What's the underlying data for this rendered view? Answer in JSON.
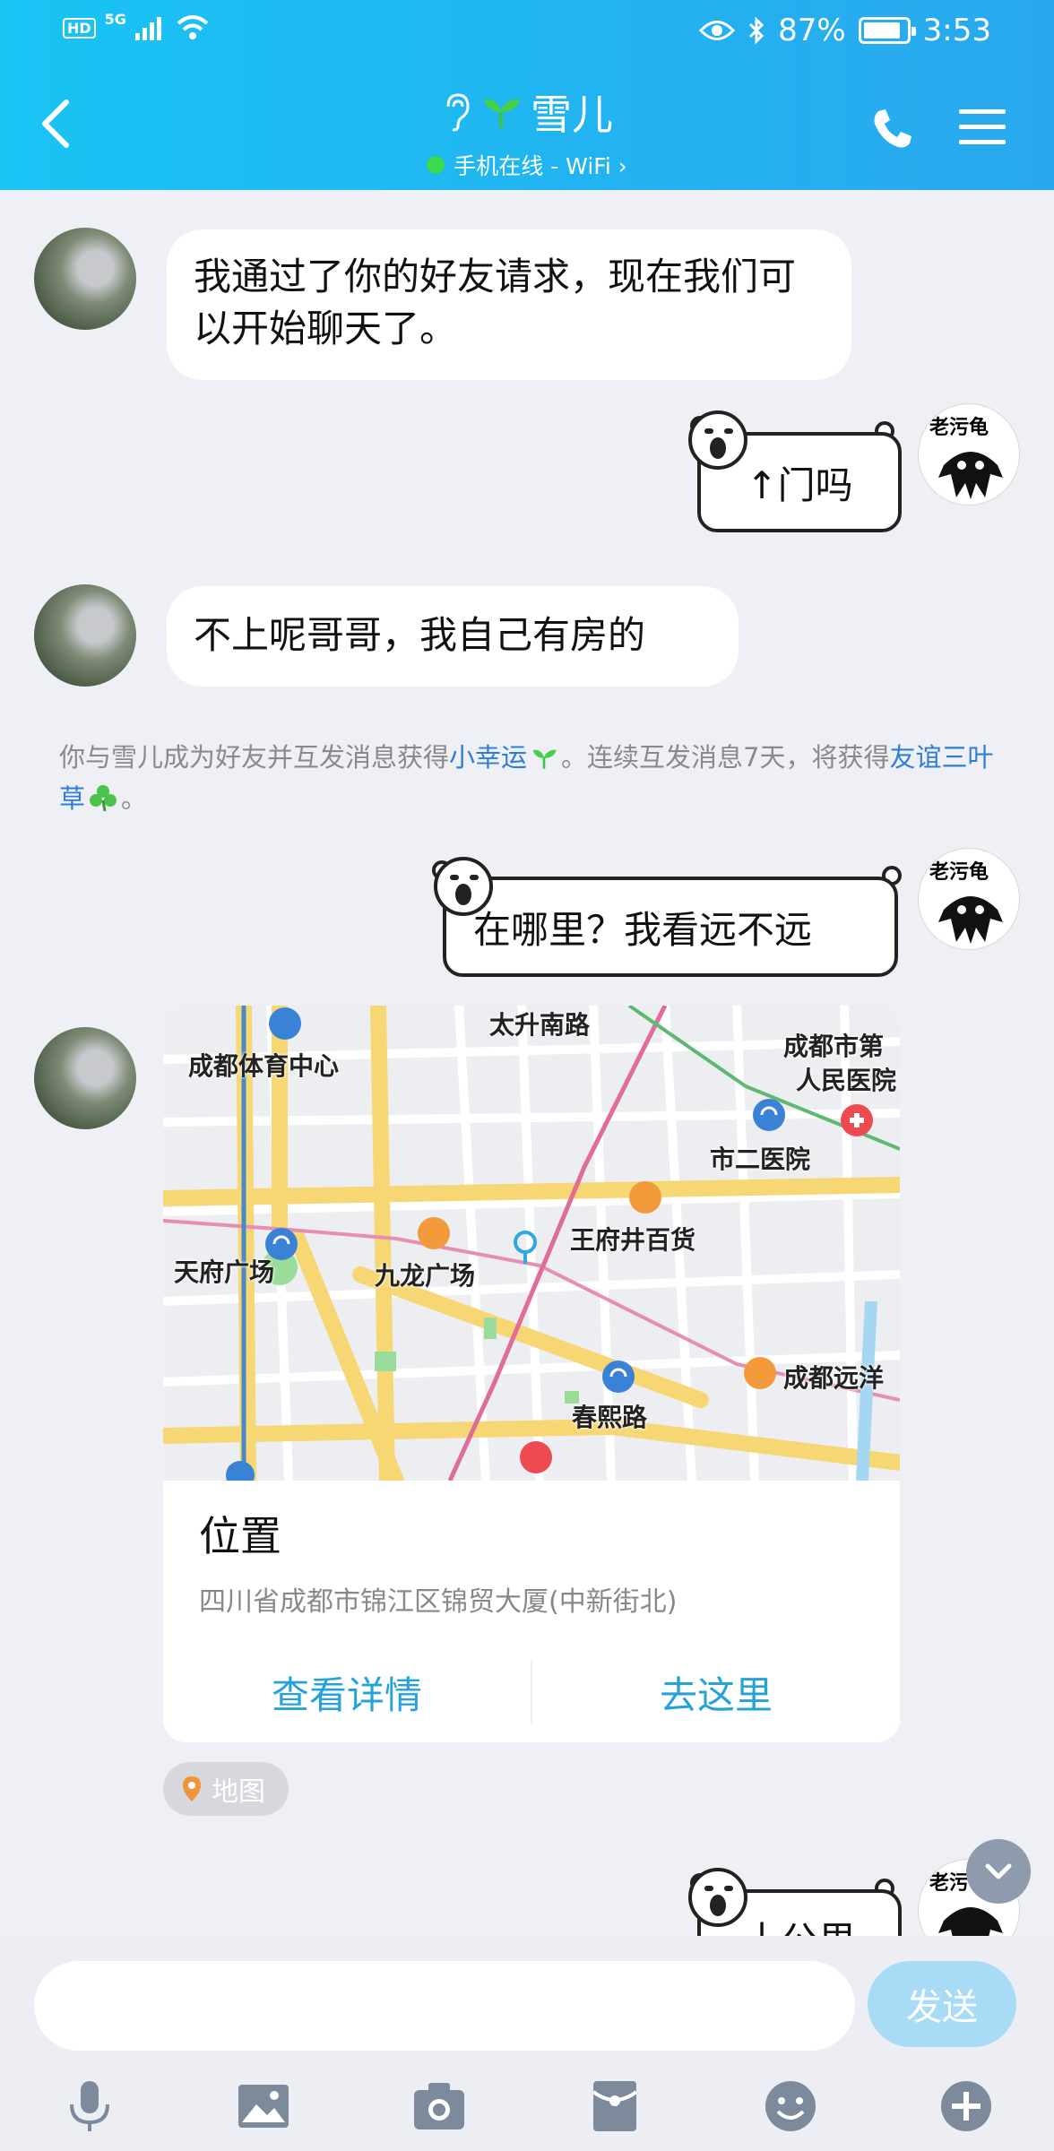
{
  "status_bar": {
    "hd": "HD",
    "network": "5G",
    "battery_pct": "87%",
    "battery_fill": 0.87,
    "time": "3:53"
  },
  "header": {
    "title": "雪儿",
    "subtitle": "手机在线 - WiFi ›"
  },
  "messages": [
    {
      "from": "other",
      "text": "我通过了你的好友请求，现在我们可以开始聊天了。"
    },
    {
      "from": "self",
      "text": "↑门吗"
    },
    {
      "from": "other",
      "text": "不上呢哥哥，我自己有房的"
    },
    {
      "from": "self",
      "text": "在哪里？我看远不远"
    },
    {
      "from": "self",
      "text": "十公里"
    }
  ],
  "self_avatar_caption": "老污龟",
  "system_message": {
    "part1": "你与雪儿成为好友并互发消息获得",
    "link1": "小幸运",
    "part2": "。连续互发消息7天，将获得",
    "link2": "友谊三叶草",
    "part3": "。"
  },
  "location_card": {
    "map_labels": {
      "l1": "太升南路",
      "l2": "成都体育中心",
      "l3": "成都市第",
      "l4": "人民医院",
      "l5": "市二医院",
      "l6": "王府井百货",
      "l7": "天府广场",
      "l8": "九龙广场",
      "l9": "成都远洋",
      "l10": "春熙路"
    },
    "title": "位置",
    "address": "四川省成都市锦江区锦贸大厦(中新街北)",
    "action_details": "查看详情",
    "action_go": "去这里"
  },
  "map_tag": "地图",
  "input": {
    "placeholder": "",
    "send": "发送"
  },
  "toolbar_icons": [
    "mic-icon",
    "image-icon",
    "camera-icon",
    "red-packet-icon",
    "emoji-icon",
    "plus-icon"
  ],
  "colors": {
    "header": "#21b4f0",
    "link": "#2e7ed6",
    "action": "#25a3d9",
    "send": "#a8dcf6"
  }
}
